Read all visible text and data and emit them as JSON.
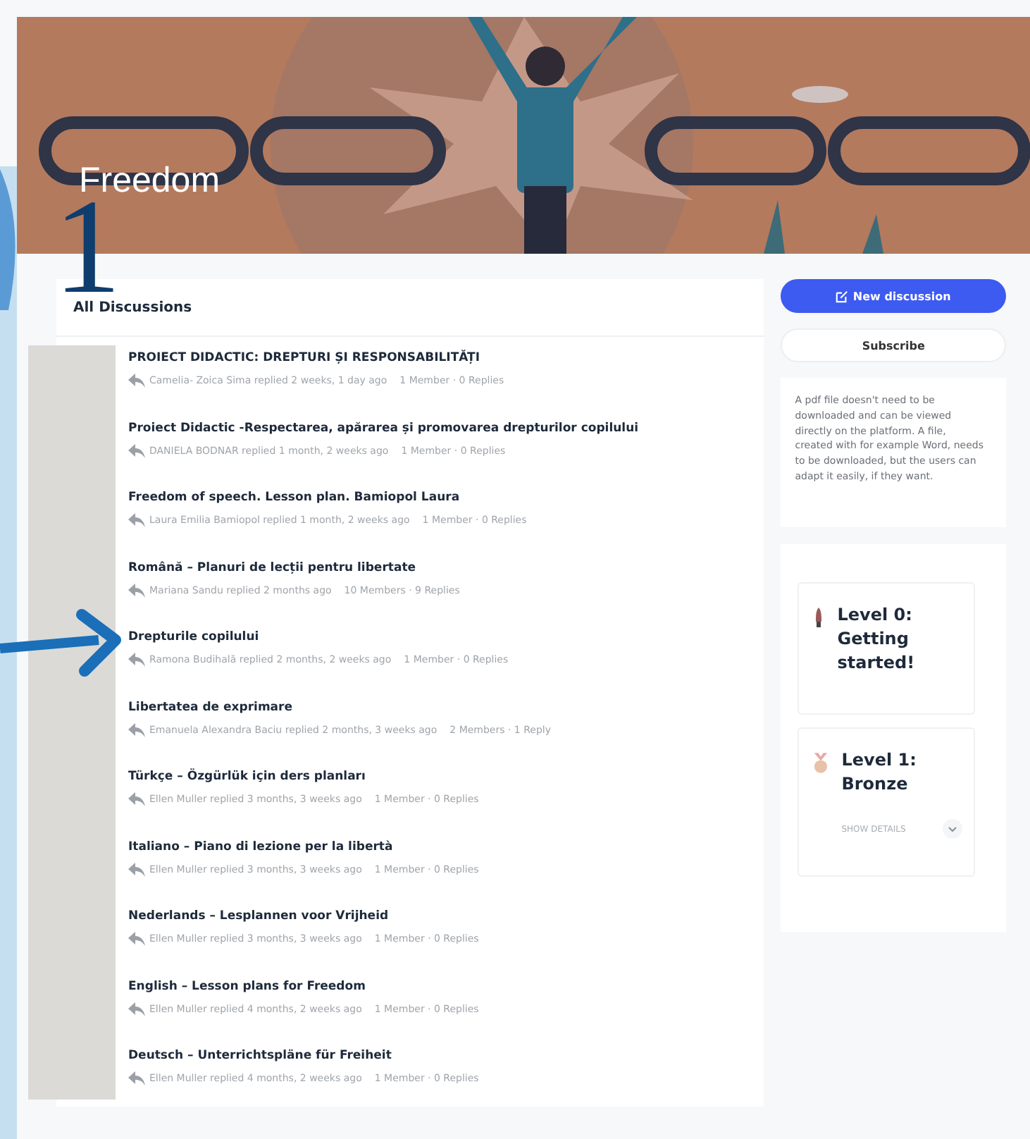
{
  "banner": {
    "title": "Freedom"
  },
  "annotation": {
    "number": "1"
  },
  "discussions": {
    "heading": "All Discussions",
    "items": [
      {
        "title": "PROIECT DIDACTIC: DREPTURI ȘI RESPONSABILITĂȚI",
        "meta": "Camelia- Zoica Sima replied 2 weeks, 1 day ago",
        "stats": "1 Member · 0 Replies"
      },
      {
        "title": "Proiect Didactic -Respectarea, apărarea și promovarea drepturilor copilului",
        "meta": "DANIELA BODNAR replied 1 month, 2 weeks ago",
        "stats": "1 Member · 0 Replies"
      },
      {
        "title": "Freedom of speech. Lesson plan. Bamiopol Laura",
        "meta": "Laura Emilia Bamiopol replied 1 month, 2 weeks ago",
        "stats": "1 Member · 0 Replies"
      },
      {
        "title": "Română – Planuri de lecții pentru libertate",
        "meta": "Mariana Sandu replied 2 months ago",
        "stats": "10 Members · 9 Replies"
      },
      {
        "title": "Drepturile copilului",
        "meta": "Ramona Budihală replied 2 months, 2 weeks ago",
        "stats": "1 Member · 0 Replies"
      },
      {
        "title": "Libertatea de exprimare",
        "meta": "Emanuela Alexandra Baciu replied 2 months, 3 weeks ago",
        "stats": "2 Members · 1 Reply"
      },
      {
        "title": "Türkçe – Özgürlük için ders planları",
        "meta": "Ellen Muller replied 3 months, 3 weeks ago",
        "stats": "1 Member · 0 Replies"
      },
      {
        "title": "Italiano – Piano di lezione per la libertà",
        "meta": "Ellen Muller replied 3 months, 3 weeks ago",
        "stats": "1 Member · 0 Replies"
      },
      {
        "title": "Nederlands – Lesplannen voor Vrijheid",
        "meta": "Ellen Muller replied 3 months, 3 weeks ago",
        "stats": "1 Member · 0 Replies"
      },
      {
        "title": "English – Lesson plans for Freedom",
        "meta": "Ellen Muller replied 4 months, 2 weeks ago",
        "stats": "1 Member · 0 Replies"
      },
      {
        "title": "Deutsch – Unterrichtspläne für Freiheit",
        "meta": "Ellen Muller replied 4 months, 2 weeks ago",
        "stats": "1 Member · 0 Replies"
      }
    ]
  },
  "sidebar": {
    "new_button": "New discussion",
    "subscribe_button": "Subscribe",
    "note": "A pdf file doesn't need to be downloaded and can be viewed directly on the platform. A file, created with for example Word, needs to be downloaded, but the users can adapt it easily, if they want.",
    "levels": [
      {
        "kind": "rocket",
        "title": "Level 0: Getting started!"
      },
      {
        "kind": "medal",
        "title": "Level 1: Bronze",
        "details": "SHOW DETAILS"
      }
    ]
  }
}
